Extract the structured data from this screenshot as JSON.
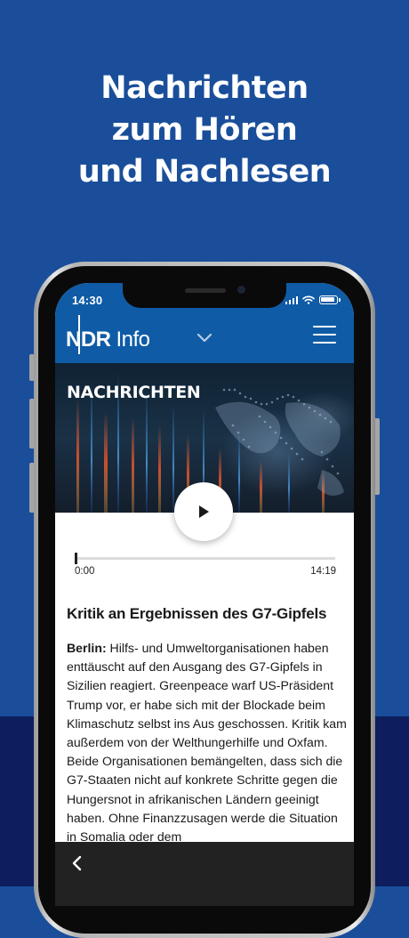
{
  "headline": {
    "lines": [
      "Nachrichten",
      "zum Hören",
      "und Nachlesen"
    ]
  },
  "status_bar": {
    "time": "14:30"
  },
  "header": {
    "logo_ndr": "NDR",
    "logo_info": "Info"
  },
  "hero": {
    "title": "NACHRICHTEN"
  },
  "player": {
    "time_start": "0:00",
    "time_end": "14:19",
    "progress": 0.0
  },
  "article": {
    "title": "Kritik an Ergebnissen des G7-Gipfels",
    "dateline": "Berlin:",
    "body": " Hilfs- und Umweltorganisationen haben enttäuscht auf den Ausgang des G7-Gipfels in Sizilien reagiert. Greenpeace warf US-Präsident Trump vor, er habe sich mit der Blockade beim Klimaschutz selbst ins Aus geschossen. Kritik kam außerdem von der Welthungerhilfe und Oxfam. Beide Organisationen bemängelten, dass sich die G7-Staaten nicht auf konkrete Schritte gegen die Hungersnot in afrikanischen Ländern geeinigt haben. Ohne Finanzzusagen werde die Situation in Somalia oder dem"
  },
  "colors": {
    "background": "#1a4e9a",
    "background_bottom": "#0d1d5e",
    "header_blue": "#0f5ba6",
    "bottom_bar": "#222222"
  },
  "icons": {
    "chevron": "chevron-down-icon",
    "menu": "hamburger-menu-icon",
    "play": "play-icon",
    "back": "chevron-left-icon"
  }
}
